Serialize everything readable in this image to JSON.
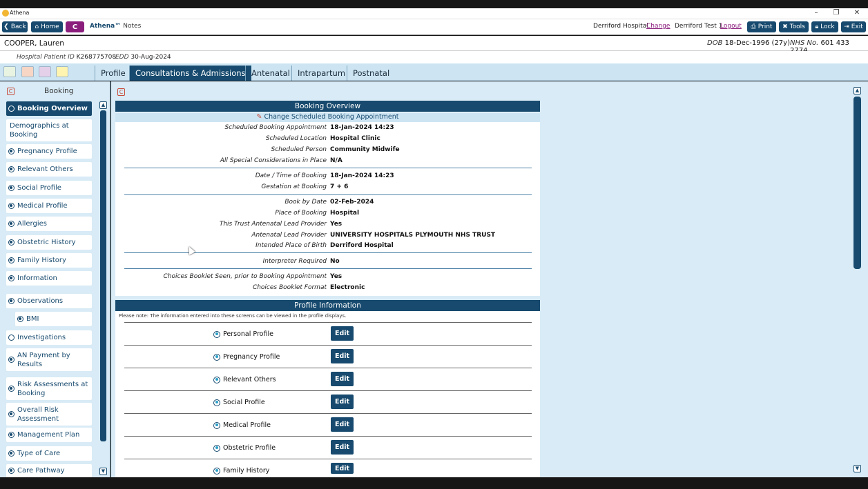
{
  "window": {
    "title": "Athena"
  },
  "toolbar": {
    "back": "Back",
    "home": "Home",
    "c_button": "C",
    "brand": "Athena™",
    "brand_sub": "Notes",
    "hospital": "Derriford Hospital",
    "change": "Change",
    "user": "Derriford Test 1",
    "logout": "Logout",
    "print": "Print",
    "tools": "Tools",
    "lock": "Lock",
    "exit": "Exit"
  },
  "patient": {
    "name": "COOPER, Lauren",
    "dob_label": "DOB",
    "dob": "18-Dec-1996 (27y)",
    "nhs_label": "NHS No.",
    "nhs": "601 433 2774",
    "hpid_label": "Hospital Patient ID",
    "hpid": "K268775708",
    "edd_label": "EDD",
    "edd": "30-Aug-2024"
  },
  "tabs": [
    "Profile",
    "Consultations & Admissions",
    "Antenatal",
    "Intrapartum",
    "Postnatal"
  ],
  "left": {
    "title": "Booking",
    "items": [
      "Booking Overview",
      "Demographics at Booking",
      "Pregnancy Profile",
      "Relevant Others",
      "Social Profile",
      "Medical Profile",
      "Allergies",
      "Obstetric History",
      "Family History",
      "Information",
      "Observations",
      "BMI",
      "Investigations",
      "AN Payment by Results",
      "Risk Assessments at Booking",
      "Overall Risk Assessment",
      "Management Plan",
      "Type of Care",
      "Care Pathway"
    ]
  },
  "overview": {
    "title": "Booking Overview",
    "change_link": "Change Scheduled Booking Appointment",
    "fields": [
      {
        "label": "Scheduled Booking Appointment",
        "value": "18-Jan-2024 14:23"
      },
      {
        "label": "Scheduled Location",
        "value": "Hospital Clinic"
      },
      {
        "label": "Scheduled Person",
        "value": "Community Midwife"
      },
      {
        "label": "All Special Considerations in Place",
        "value": "N/A"
      },
      {
        "label": "Date / Time of Booking",
        "value": "18-Jan-2024 14:23"
      },
      {
        "label": "Gestation at Booking",
        "value": "7 + 6"
      },
      {
        "label": "Book by Date",
        "value": "02-Feb-2024"
      },
      {
        "label": "Place of Booking",
        "value": "Hospital"
      },
      {
        "label": "This Trust Antenatal Lead Provider",
        "value": "Yes"
      },
      {
        "label": "Antenatal Lead Provider",
        "value": "UNIVERSITY HOSPITALS PLYMOUTH NHS TRUST"
      },
      {
        "label": "Intended Place of Birth",
        "value": "Derriford Hospital"
      },
      {
        "label": "Interpreter Required",
        "value": "No"
      },
      {
        "label": "Choices Booklet Seen, prior to Booking Appointment",
        "value": "Yes"
      },
      {
        "label": "Choices Booklet Format",
        "value": "Electronic"
      }
    ]
  },
  "profile": {
    "title": "Profile Information",
    "note": "Please note: The information entered into these screens can be viewed in the profile displays.",
    "edit_label": "Edit",
    "items": [
      "Personal Profile",
      "Pregnancy Profile",
      "Relevant Others",
      "Social Profile",
      "Medical Profile",
      "Obstetric Profile",
      "Family History"
    ]
  },
  "colors": {
    "primary": "#174a6e",
    "tab_bg": "#cde5f3",
    "c_button": "#8b1e7d",
    "link": "#8b1e7d"
  }
}
